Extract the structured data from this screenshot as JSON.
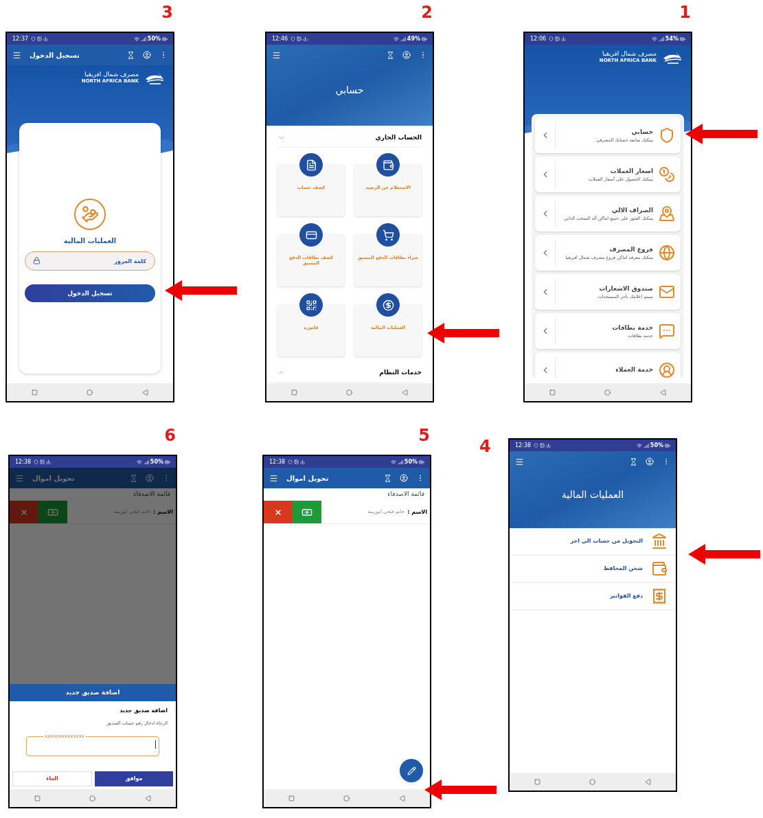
{
  "screens": [
    {
      "number": "1",
      "kind": "menu",
      "arrow": true,
      "status": {
        "time": "12:06",
        "battery": "54%"
      },
      "bank": {
        "name_ar": "مصرف شمال افريقيا",
        "name_en": "NORTH AFRICA BANK"
      },
      "items": [
        {
          "title": "حسابي",
          "subtitle": "يمكنك متابعة حسابك المصرفي"
        },
        {
          "title": "اسعار العملات",
          "subtitle": "يمكنك الحصول على أسعار العملات"
        },
        {
          "title": "الصراف الالي",
          "subtitle": "يمكنك العثور على جميع اماكن آلة السحب الذاتي"
        },
        {
          "title": "فروع المصرف",
          "subtitle": "يمكنك معرفة اماكن فروع مصرف شمال افريقيا"
        },
        {
          "title": "صندوق الاشعارات",
          "subtitle": "سيتم اعلامك بأخر المستجدات"
        },
        {
          "title": "خدمة بطاقات",
          "subtitle": "خدمة بطاقات"
        },
        {
          "title": "خدمة العملاء"
        }
      ]
    },
    {
      "number": "2",
      "kind": "account",
      "arrow": true,
      "status": {
        "time": "12:46",
        "battery": "49%"
      },
      "header_title": "حسابي",
      "sections": [
        {
          "title": "الحساب الجاري",
          "expanded": true,
          "tiles": [
            "الاستعلام عن الرصيد",
            "كشف حساب",
            "شراء بطاقات الدفع المسبق",
            "كشف بطاقات الدفع المسبق",
            "العمليات المالية",
            "فاتورة"
          ]
        },
        {
          "title": "خدمات النظام",
          "expanded": false
        }
      ]
    },
    {
      "number": "3",
      "kind": "login",
      "arrow": true,
      "status": {
        "time": "12:37",
        "battery": "50%"
      },
      "app_bar": {
        "title": "تسجيل الدخول"
      },
      "bank": {
        "name_ar": "مصرف شمال افريقيا",
        "name_en": "NORTH AFRICA BANK"
      },
      "card": {
        "title": "العمليات المالية",
        "password_placeholder": "كلمة المرور",
        "login_button": "تسجيل الدخول"
      }
    },
    {
      "number": "4",
      "kind": "operations",
      "arrow": true,
      "status": {
        "time": "12:38",
        "battery": "50%"
      },
      "header_title": "العمليات المالية",
      "items": [
        {
          "title": "التحويل من حساب الي اخر"
        },
        {
          "title": "شحن المحافظ"
        },
        {
          "title": "دفع الفواتير"
        }
      ]
    },
    {
      "number": "5",
      "kind": "friends",
      "arrow": true,
      "fab": true,
      "status": {
        "time": "12:38",
        "battery": "50%"
      },
      "app_bar": {
        "title": "تحويل اموال"
      },
      "list_title": "قائمة الاصدقاء",
      "friends": [
        {
          "label": "الاسم :",
          "name": "حاتم فتحي ابوزيمة"
        }
      ]
    },
    {
      "number": "6",
      "kind": "friends",
      "status": {
        "time": "12:38",
        "battery": "50%"
      },
      "app_bar": {
        "title": "تحويل اموال"
      },
      "list_title": "قائمة الاصدقاء",
      "friends": [
        {
          "label": "الاسم :",
          "name": "حاتم فتحي ابوزيمة"
        }
      ],
      "dialog": {
        "header": "اضافة صديق جديد",
        "title": "اضافة صديق جديد",
        "prompt": "الرجاء ادخال رقم حساب الصديق",
        "field_label": "xxxxxxxxxxxxxx",
        "cancel": "الغاء",
        "ok": "موافق"
      }
    }
  ]
}
